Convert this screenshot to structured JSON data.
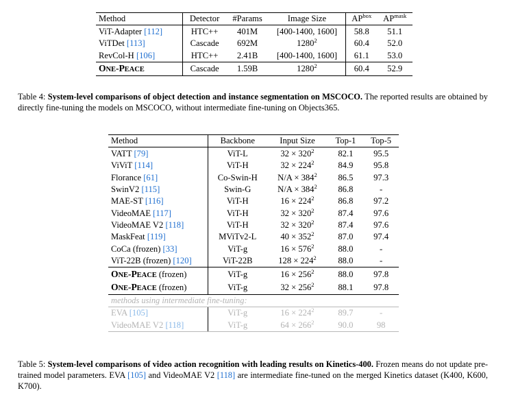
{
  "document": {
    "type": "academic-paper-excerpt"
  },
  "table4": {
    "id": "Table 4",
    "columns": [
      "Method",
      "Detector",
      "#Params",
      "Image Size",
      "AP",
      "AP"
    ],
    "column_sup": [
      "",
      "",
      "",
      "",
      "box",
      "mask"
    ],
    "rows": [
      {
        "method": "ViT-Adapter",
        "cite": "[112]",
        "detector": "HTC++",
        "params": "401M",
        "image_size": "[400-1400, 1600]",
        "image_size_sup": "",
        "ap_box": "58.8",
        "ap_mask": "51.1",
        "bold_ap_box": false,
        "bold_ap_mask": false
      },
      {
        "method": "ViTDet",
        "cite": "[113]",
        "detector": "Cascade",
        "params": "692M",
        "image_size": "1280",
        "image_size_sup": "2",
        "ap_box": "60.4",
        "ap_mask": "52.0",
        "bold_ap_box": false,
        "bold_ap_mask": false
      },
      {
        "method": "RevCol-H",
        "cite": "[106]",
        "detector": "HTC++",
        "params": "2.41B",
        "image_size": "[400-1400, 1600]",
        "image_size_sup": "",
        "ap_box": "61.1",
        "ap_mask": "53.0",
        "bold_ap_box": true,
        "bold_ap_mask": true
      }
    ],
    "ours": {
      "logo_one": "O",
      "logo_ne": "NE",
      "logo_dash": "-",
      "logo_p": "P",
      "logo_eace": "EACE",
      "detector": "Cascade",
      "params": "1.59B",
      "image_size": "1280",
      "image_size_sup": "2",
      "ap_box": "60.4",
      "ap_mask": "52.9"
    },
    "caption_label": "Table 4:",
    "caption_bold": "System-level comparisons of object detection and instance segmentation on MSCOCO.",
    "caption_rest": "The reported results are obtained by directly fine-tuning the models on MSCOCO, without intermediate fine-tuning on Objects365."
  },
  "table5": {
    "id": "Table 5",
    "columns": [
      "Method",
      "Backbone",
      "Input Size",
      "Top-1",
      "Top-5"
    ],
    "rows": [
      {
        "method": "VATT",
        "cite": "[79]",
        "backbone": "ViT-L",
        "input_a": "32 × 320",
        "input_sup": "2",
        "top1": "82.1",
        "top5": "95.5",
        "bold_top1": false,
        "bold_top5": false,
        "faded": false
      },
      {
        "method": "ViViT",
        "cite": "[114]",
        "backbone": "ViT-H",
        "input_a": "32 × 224",
        "input_sup": "2",
        "top1": "84.9",
        "top5": "95.8",
        "bold_top1": false,
        "bold_top5": false,
        "faded": false
      },
      {
        "method": "Florance",
        "cite": "[61]",
        "backbone": "Co-Swin-H",
        "input_a": "N/A × 384",
        "input_sup": "2",
        "top1": "86.5",
        "top5": "97.3",
        "bold_top1": false,
        "bold_top5": false,
        "faded": false
      },
      {
        "method": "SwinV2",
        "cite": "[115]",
        "backbone": "Swin-G",
        "input_a": "N/A × 384",
        "input_sup": "2",
        "top1": "86.8",
        "top5": "-",
        "bold_top1": false,
        "bold_top5": false,
        "faded": false
      },
      {
        "method": "MAE-ST",
        "cite": "[116]",
        "backbone": "ViT-H",
        "input_a": "16 × 224",
        "input_sup": "2",
        "top1": "86.8",
        "top5": "97.2",
        "bold_top1": false,
        "bold_top5": false,
        "faded": false
      },
      {
        "method": "VideoMAE",
        "cite": "[117]",
        "backbone": "ViT-H",
        "input_a": "32 × 320",
        "input_sup": "2",
        "top1": "87.4",
        "top5": "97.6",
        "bold_top1": false,
        "bold_top5": false,
        "faded": false
      },
      {
        "method": "VideoMAE V2",
        "cite": "[118]",
        "backbone": "ViT-H",
        "input_a": "32 × 320",
        "input_sup": "2",
        "top1": "87.4",
        "top5": "97.6",
        "bold_top1": false,
        "bold_top5": false,
        "faded": false
      },
      {
        "method": "MaskFeat",
        "cite": "[119]",
        "backbone": "MViTv2-L",
        "input_a": "40 × 352",
        "input_sup": "2",
        "top1": "87.0",
        "top5": "97.4",
        "bold_top1": false,
        "bold_top5": false,
        "faded": false
      },
      {
        "method": "CoCa (frozen)",
        "cite": "[33]",
        "backbone": "ViT-g",
        "input_a": "16 × 576",
        "input_sup": "2",
        "top1": "88.0",
        "top5": "-",
        "bold_top1": false,
        "bold_top5": false,
        "faded": false
      },
      {
        "method": "ViT-22B (frozen)",
        "cite": "[120]",
        "backbone": "ViT-22B",
        "input_a": "128 × 224",
        "input_sup": "2",
        "top1": "88.0",
        "top5": "-",
        "bold_top1": false,
        "bold_top5": false,
        "faded": false
      }
    ],
    "ours": [
      {
        "logo_one": "O",
        "logo_ne": "NE",
        "logo_dash": "-",
        "logo_p": "P",
        "logo_eace": "EACE",
        "suffix": " (frozen)",
        "backbone": "ViT-g",
        "input_a": "16 × 256",
        "input_sup": "2",
        "top1": "88.0",
        "top5": "97.8",
        "bold_top1": false,
        "bold_top5": true
      },
      {
        "logo_one": "O",
        "logo_ne": "NE",
        "logo_dash": "-",
        "logo_p": "P",
        "logo_eace": "EACE",
        "suffix": " (frozen)",
        "backbone": "ViT-g",
        "input_a": "32 × 256",
        "input_sup": "2",
        "top1": "88.1",
        "top5": "97.8",
        "bold_top1": true,
        "bold_top5": true
      }
    ],
    "section_label": "methods using intermediate fine-tuning:",
    "faded_rows": [
      {
        "method": "EVA",
        "cite": "[105]",
        "backbone": "ViT-g",
        "input_a": "16 × 224",
        "input_sup": "2",
        "top1": "89.7",
        "top5": "-"
      },
      {
        "method": "VideoMAE V2",
        "cite": "[118]",
        "backbone": "ViT-g",
        "input_a": "64 × 266",
        "input_sup": "2",
        "top1": "90.0",
        "top5": "98"
      }
    ],
    "caption_label": "Table 5:",
    "caption_bold": "System-level comparisons of video action recognition with leading results on Kinetics-400.",
    "caption_rest_1": "Frozen means do not update pre-trained model parameters. EVA",
    "caption_cite_1": "[105]",
    "caption_rest_2": "and VideoMAE V2",
    "caption_cite_2": "[118]",
    "caption_rest_3": "are intermediate fine-tuned on the merged Kinetics dataset (K400, K600, K700)."
  },
  "colors": {
    "citation_blue": "#1f6fd0",
    "faded_gray": "#b3b3b3",
    "text_black": "#000000",
    "background": "#ffffff"
  }
}
